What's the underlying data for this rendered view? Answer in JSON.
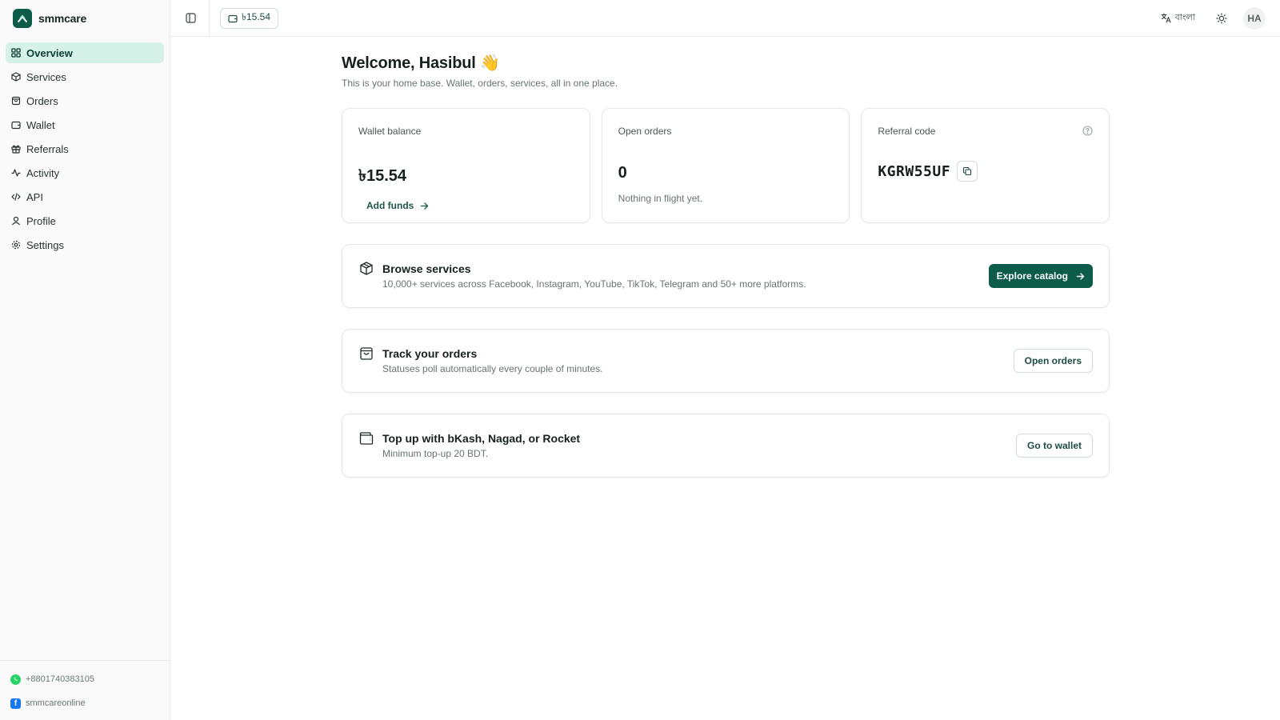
{
  "brand": {
    "name": "smmcare"
  },
  "sidebar": {
    "items": [
      {
        "label": "Overview",
        "icon": "grid-icon",
        "active": true
      },
      {
        "label": "Services",
        "icon": "package-icon"
      },
      {
        "label": "Orders",
        "icon": "bag-icon"
      },
      {
        "label": "Wallet",
        "icon": "wallet-icon"
      },
      {
        "label": "Referrals",
        "icon": "gift-icon"
      },
      {
        "label": "Activity",
        "icon": "activity-icon"
      },
      {
        "label": "API",
        "icon": "code-icon"
      },
      {
        "label": "Profile",
        "icon": "user-icon"
      },
      {
        "label": "Settings",
        "icon": "gear-icon"
      }
    ],
    "footer": {
      "whatsapp": "+8801740383105",
      "facebook": "smmcareonline"
    }
  },
  "topbar": {
    "balance": "৳15.54",
    "language": "বাংলা",
    "avatar_initials": "HA"
  },
  "main": {
    "welcome": "Welcome, Hasibul 👋",
    "subtitle": "This is your home base. Wallet, orders, services, all in one place.",
    "stats": {
      "wallet": {
        "label": "Wallet balance",
        "value": "৳15.54",
        "link": "Add funds"
      },
      "orders": {
        "label": "Open orders",
        "value": "0",
        "sub": "Nothing in flight yet."
      },
      "referral": {
        "label": "Referral code",
        "code": "KGRW55UF"
      }
    },
    "actions": [
      {
        "title": "Browse services",
        "desc": "10,000+ services across Facebook, Instagram, YouTube, TikTok, Telegram and 50+ more platforms.",
        "button": "Explore catalog"
      },
      {
        "title": "Track your orders",
        "desc": "Statuses poll automatically every couple of minutes.",
        "button": "Open orders"
      },
      {
        "title": "Top up with bKash, Nagad, or Rocket",
        "desc": "Minimum top-up 20 BDT.",
        "button": "Go to wallet"
      }
    ]
  },
  "colors": {
    "accent": "#0d5c4a",
    "active_bg": "#d5f1e8",
    "whatsapp": "#25d366",
    "facebook": "#1877f2"
  }
}
